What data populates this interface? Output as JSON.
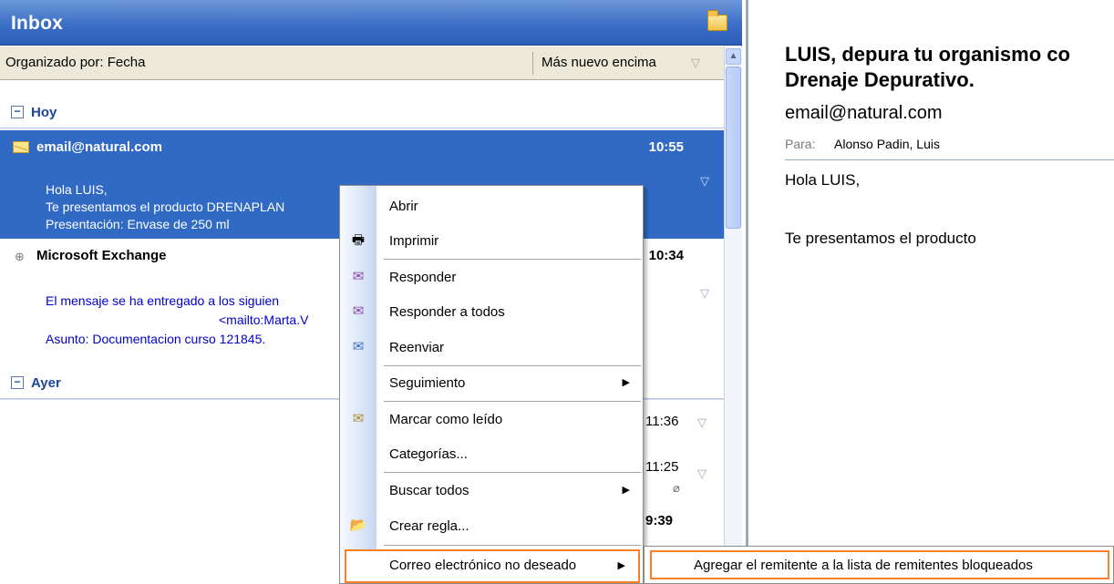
{
  "inbox": {
    "title": "Inbox",
    "sort_label": "Organizado por: Fecha",
    "sort_order": "Más nuevo encima"
  },
  "groups": [
    {
      "label": "Hoy"
    },
    {
      "label": "Ayer"
    }
  ],
  "mails": [
    {
      "from": "email@natural.com",
      "time": "10:55",
      "preview": [
        "Hola LUIS,",
        "Te presentamos el producto DRENAPLAN",
        "Presentación: Envase de 250 ml"
      ]
    },
    {
      "from": "Microsoft Exchange",
      "time": "10:34",
      "preview": [
        "El mensaje se ha entregado a los siguien",
        "<mailto:Marta.V",
        "Asunto: Documentacion curso 121845."
      ]
    }
  ],
  "yesterday_times": [
    "11:36",
    "11:25",
    "9:39"
  ],
  "reading": {
    "subject_line1": "LUIS, depura tu organismo co",
    "subject_line2": "Drenaje Depurativo.",
    "from": "email@natural.com",
    "to_label": "Para:",
    "to_value": "Alonso Padin, Luis",
    "body_greeting": "Hola LUIS,",
    "body_text": "Te presentamos el producto"
  },
  "context_menu": {
    "items": [
      {
        "label": "Abrir"
      },
      {
        "label": "Imprimir"
      },
      {
        "label": "Responder"
      },
      {
        "label": "Responder a todos"
      },
      {
        "label": "Reenviar"
      },
      {
        "label": "Seguimiento"
      },
      {
        "label": "Marcar como leído"
      },
      {
        "label": "Categorías..."
      },
      {
        "label": "Buscar todos"
      },
      {
        "label": "Crear regla..."
      },
      {
        "label": "Correo electrónico no deseado"
      }
    ]
  },
  "submenu": {
    "item": "Agregar el remitente a la lista de remitentes bloqueados"
  },
  "colors": {
    "selection": "#316ac5",
    "highlight_border": "#ff7f27",
    "group_text": "#1c4597"
  }
}
